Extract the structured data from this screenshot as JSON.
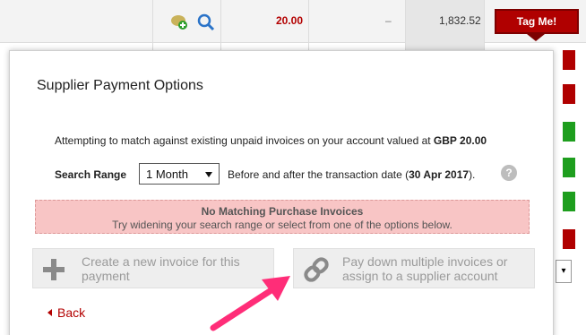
{
  "table": {
    "amount_red": "20.00",
    "amount_dash": "–",
    "balance": "1,832.52",
    "tag_button": "Tag Me!"
  },
  "modal": {
    "title": "Supplier Payment Options",
    "match_text_prefix": "Attempting to match against existing unpaid invoices on your account valued at ",
    "match_amount": "GBP 20.00",
    "search_range_label": "Search Range",
    "search_range_value": "1 Month",
    "range_help_prefix": "Before and after the transaction date (",
    "range_help_date": "30 Apr 2017",
    "range_help_suffix": ").",
    "alert_title": "No Matching Purchase Invoices",
    "alert_sub": "Try widening your search range or select from one of the options below.",
    "option_create": "Create a new invoice for this payment",
    "option_paydown": "Pay down multiple invoices or assign to a supplier account",
    "back_label": "Back",
    "help_glyph": "?"
  },
  "colors": {
    "brand_red": "#b00000",
    "alert_bg": "#f8c5c5",
    "annotation_pink": "#ff2d78",
    "side_green": "#1e9e1e"
  }
}
